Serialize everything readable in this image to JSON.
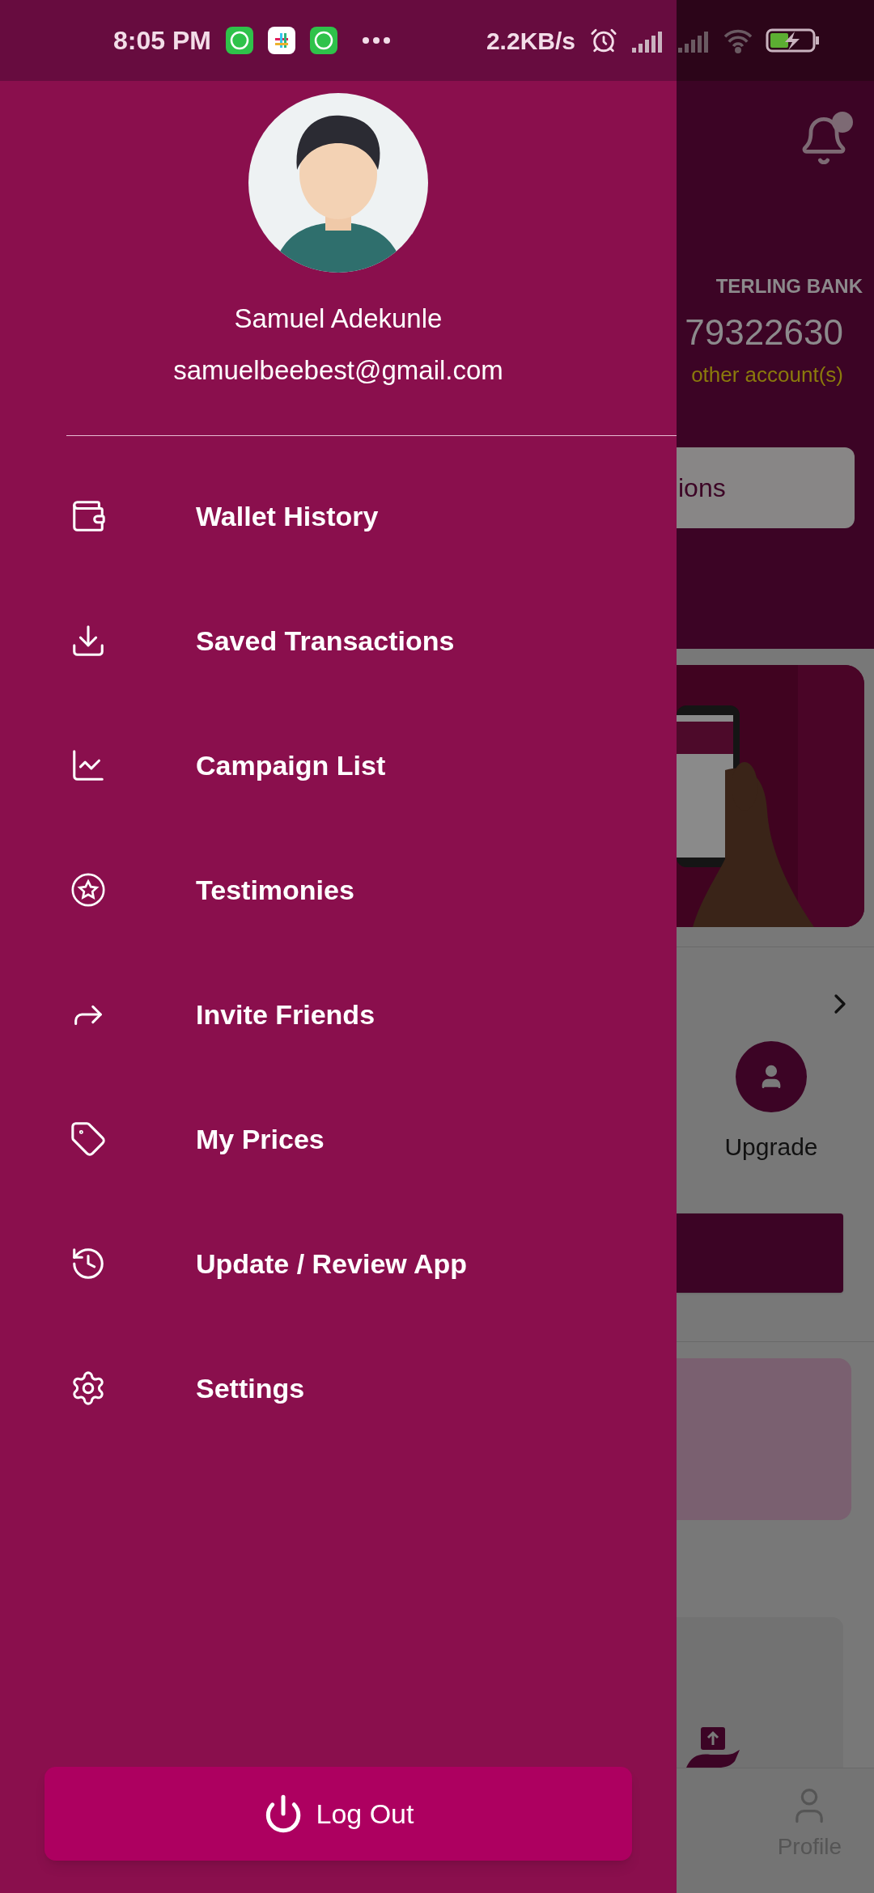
{
  "status_bar": {
    "time": "8:05 PM",
    "net_speed": "2.2KB/s"
  },
  "drawer": {
    "user": {
      "name": "Samuel Adekunle",
      "email": "samuelbeebest@gmail.com"
    },
    "menu": [
      {
        "label": "Wallet History",
        "kind": "wallet"
      },
      {
        "label": "Saved Transactions",
        "kind": "download"
      },
      {
        "label": "Campaign List",
        "kind": "chart"
      },
      {
        "label": "Testimonies",
        "kind": "star"
      },
      {
        "label": "Invite Friends",
        "kind": "share"
      },
      {
        "label": "My Prices",
        "kind": "tag"
      },
      {
        "label": "Update / Review App",
        "kind": "update"
      },
      {
        "label": "Settings",
        "kind": "settings"
      }
    ],
    "logout": "Log Out"
  },
  "background_screen": {
    "bank_name": "TERLING BANK",
    "account_number": "79322630",
    "accounts_link": "other account(s)",
    "button": "ions",
    "upgrade": "Upgrade",
    "nav": [
      {
        "label": "Profile"
      }
    ]
  }
}
